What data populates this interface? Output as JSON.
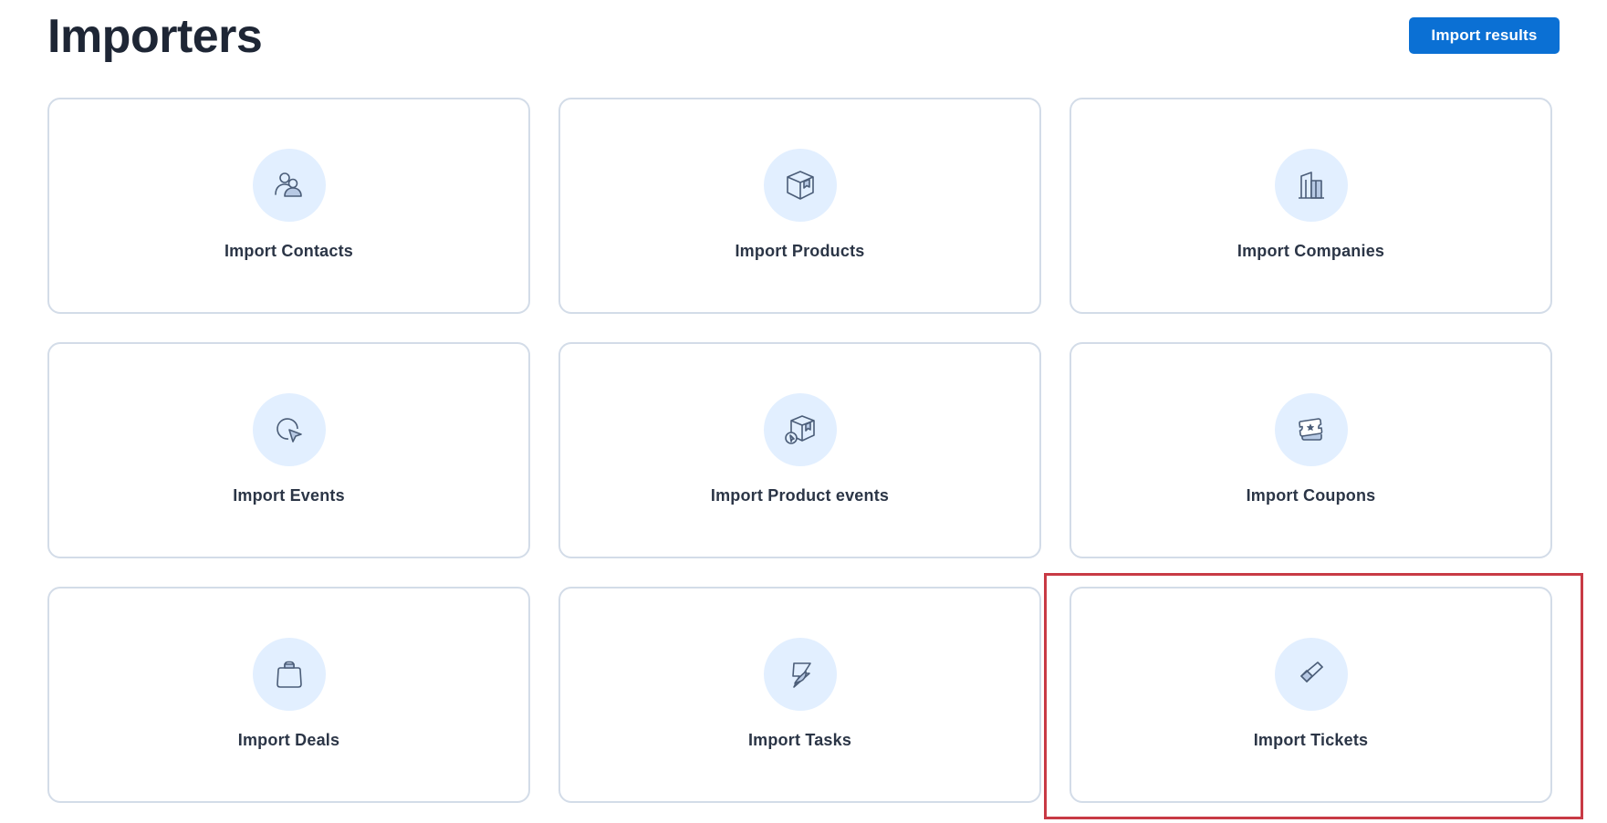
{
  "header": {
    "title": "Importers",
    "import_results_label": "Import results"
  },
  "importers": [
    {
      "label": "Import Contacts",
      "icon": "contacts-icon"
    },
    {
      "label": "Import Products",
      "icon": "product-box-icon"
    },
    {
      "label": "Import Companies",
      "icon": "building-icon"
    },
    {
      "label": "Import Events",
      "icon": "cursor-click-icon"
    },
    {
      "label": "Import Product events",
      "icon": "product-event-icon"
    },
    {
      "label": "Import Coupons",
      "icon": "coupon-ticket-icon"
    },
    {
      "label": "Import Deals",
      "icon": "shopping-bag-icon"
    },
    {
      "label": "Import Tasks",
      "icon": "feather-bolt-icon"
    },
    {
      "label": "Import Tickets",
      "icon": "ticket-check-icon"
    }
  ],
  "highlighted_importer": "Import Tickets",
  "colors": {
    "primary_button": "#0b70d4",
    "icon_circle": "#e2efff",
    "icon_stroke": "#4b5d78",
    "card_border": "#d3dce8",
    "highlight": "#c83a45"
  }
}
